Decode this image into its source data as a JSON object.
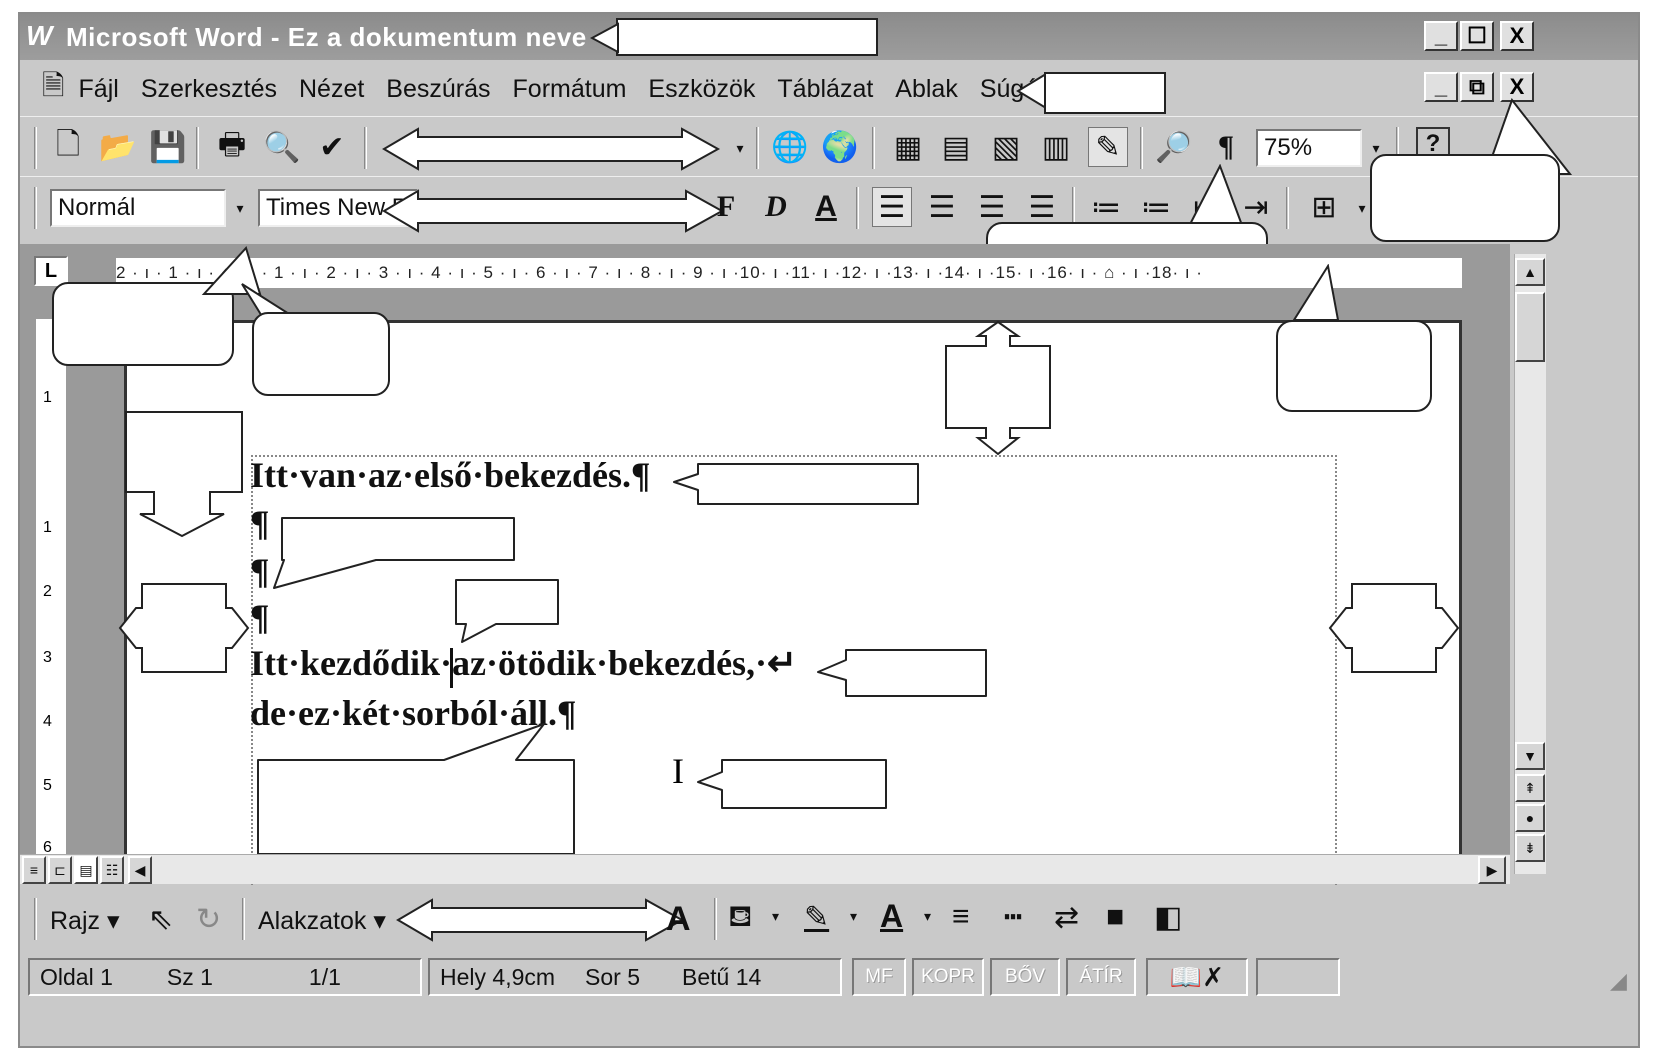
{
  "window": {
    "title": "Microsoft Word - Ez a dokumentum neve",
    "app_icon": "word-w-icon",
    "controls": [
      "_",
      "☐",
      "X"
    ]
  },
  "menubar": {
    "items": [
      "Fájl",
      "Szerkesztés",
      "Nézet",
      "Beszúrás",
      "Formátum",
      "Eszközök",
      "Táblázat",
      "Ablak",
      "Súgó"
    ],
    "doc_controls": [
      "_",
      "⧉",
      "X"
    ]
  },
  "standard_toolbar": {
    "zoom": "75%",
    "help": "?",
    "pilcrow": "¶"
  },
  "format_toolbar": {
    "style": "Normál",
    "font": "Times New R",
    "bold": "F",
    "italic": "D",
    "underline": "A"
  },
  "ruler": {
    "corner": "L",
    "text": "2 · ı · 1 · ı · ⌂ · ı · 1 · ı · 2 · ı · 3 · ı · 4 · ı · 5 · ı · 6 · ı · 7 · ı · 8 · ı · 9 · ı ·10· ı ·11· ı ·12· ı ·13· ı ·14· ı ·15· ı ·16· ı · ⌂ · ı ·18· ı ·",
    "vertical_marks": [
      "1",
      "1",
      "2",
      "3",
      "4",
      "5",
      "6"
    ]
  },
  "document": {
    "p1": "Itt·van·az·első·bekezdés.¶",
    "p2": "¶",
    "p3": "¶",
    "p4": "¶",
    "p5a": "Itt·kezdődik·az·ötödik·bekezdés,·↵",
    "p5b": "de·ez·két·sorból·áll.¶"
  },
  "drawing_toolbar": {
    "draw": "Rajz ▾",
    "shapes": "Alakzatok ▾"
  },
  "statusbar": {
    "page": "Oldal 1",
    "section": "Sz 1",
    "pages": "1/1",
    "position": "Hely 4,9cm",
    "line": "Sor 5",
    "column": "Betű 14",
    "modes": [
      "MF",
      "KOPR",
      "BŐV",
      "ÁTÍR"
    ]
  }
}
